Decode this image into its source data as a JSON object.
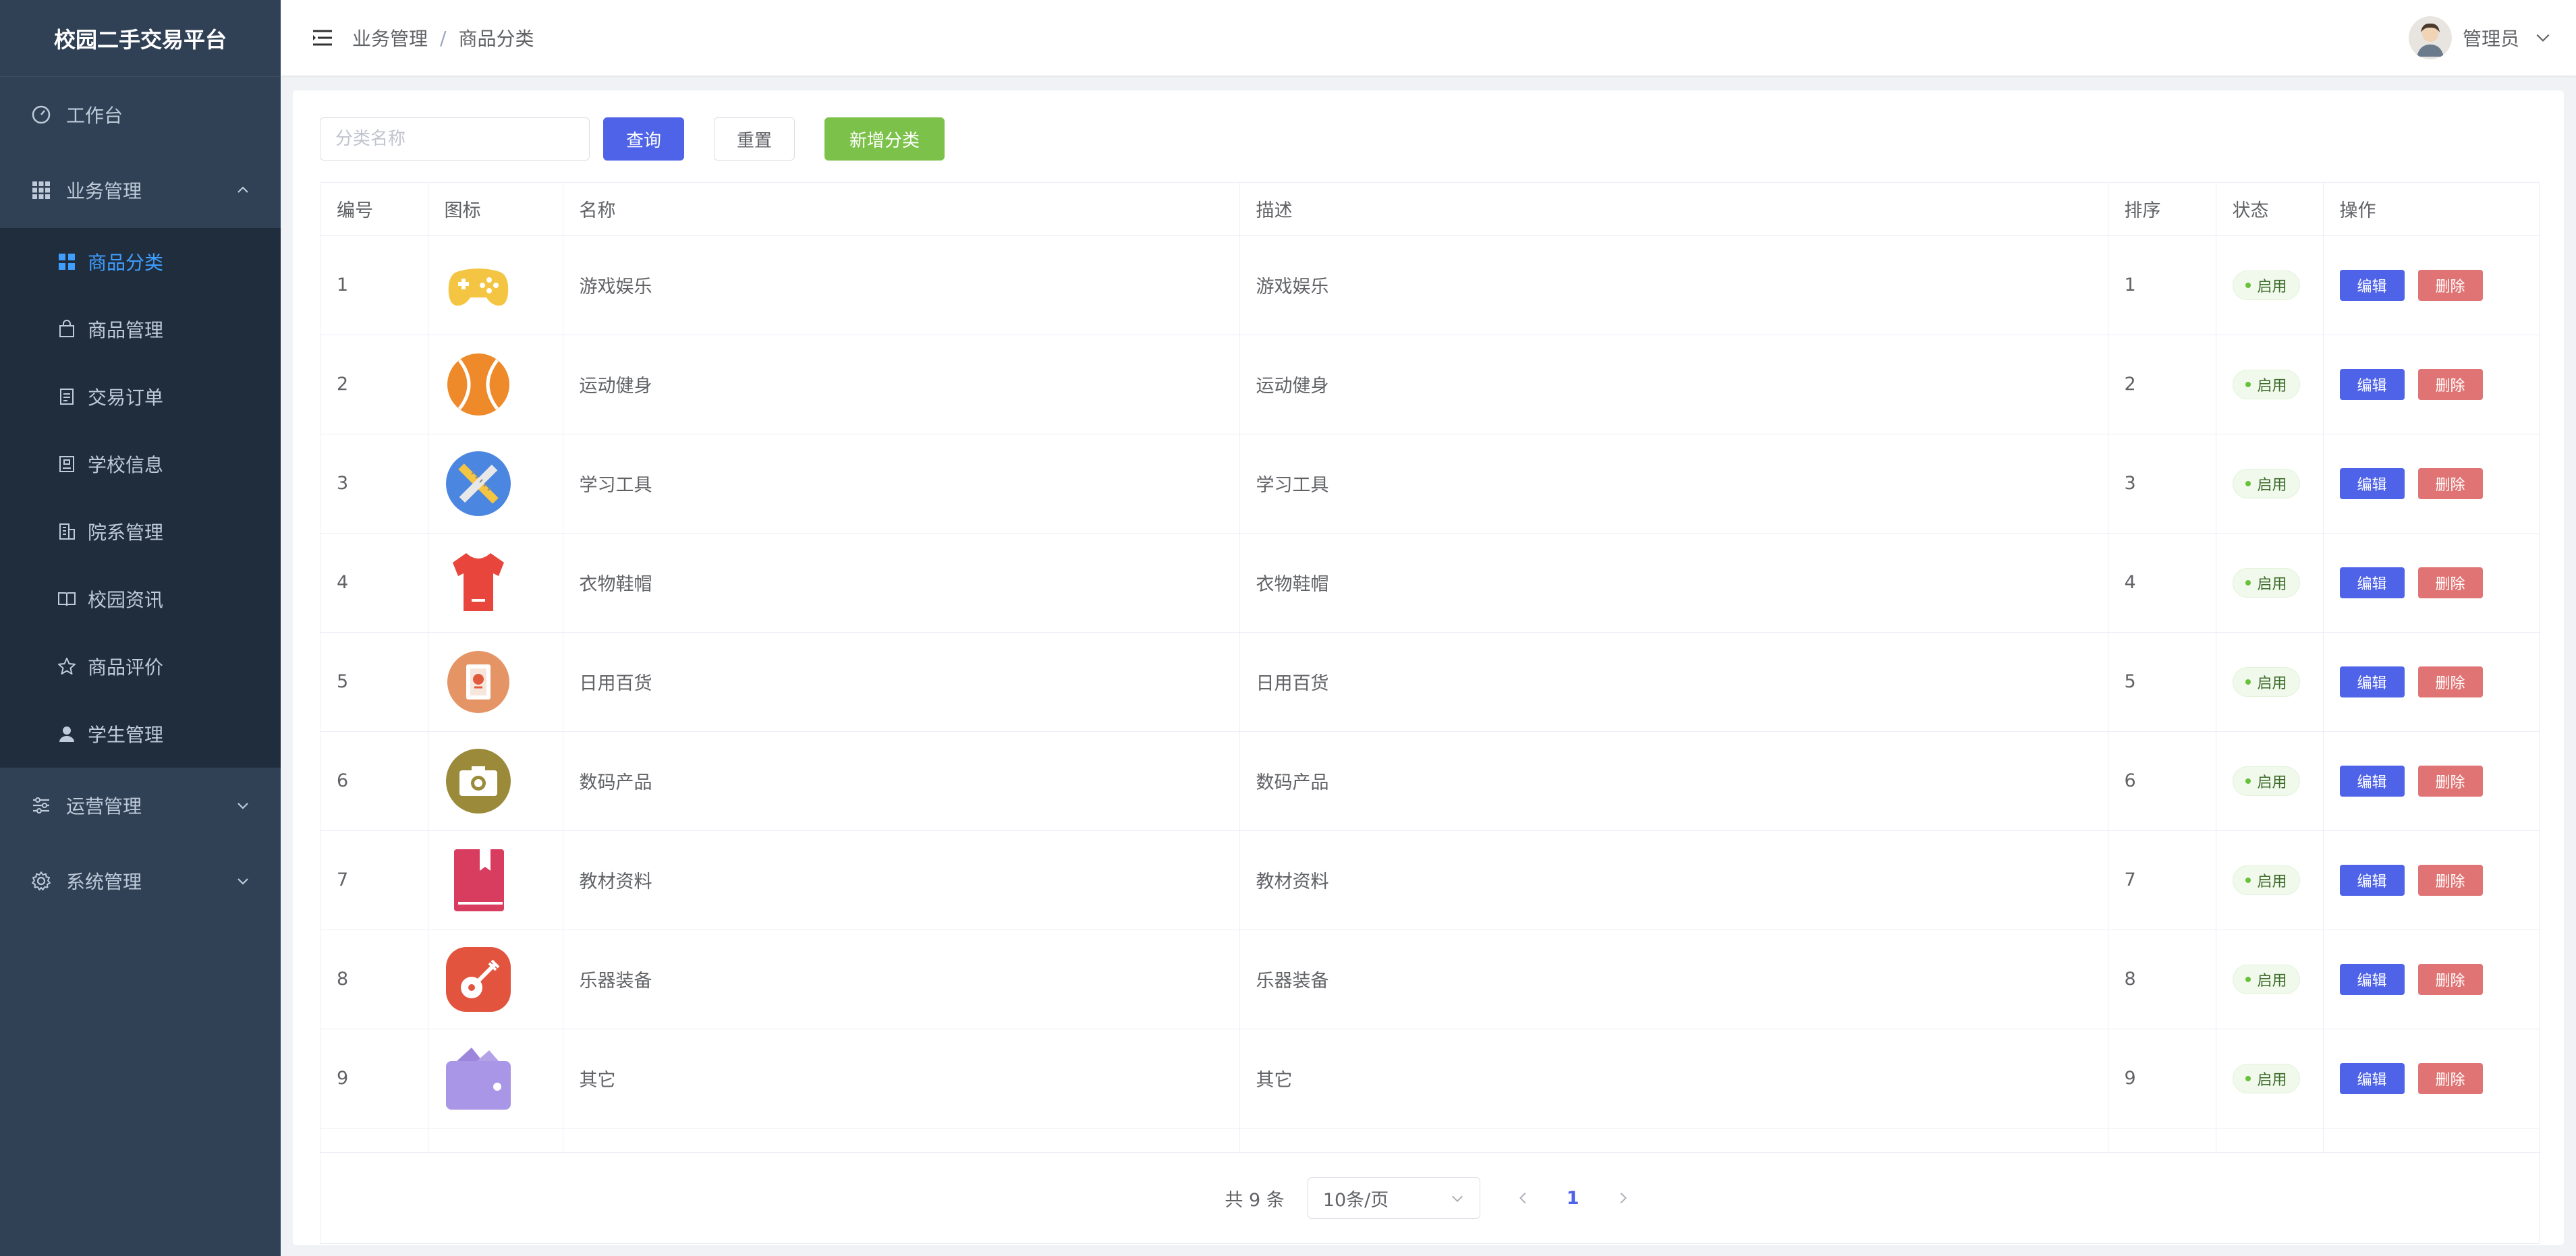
{
  "app": {
    "title": "校园二手交易平台"
  },
  "sidebar": {
    "workbench": "工作台",
    "business": {
      "label": "业务管理",
      "items": [
        "商品分类",
        "商品管理",
        "交易订单",
        "学校信息",
        "院系管理",
        "校园资讯",
        "商品评价",
        "学生管理"
      ]
    },
    "operation": "运营管理",
    "system": "系统管理"
  },
  "header": {
    "breadcrumb": [
      "业务管理",
      "商品分类"
    ],
    "breadcrumb_sep": "/",
    "user": "管理员"
  },
  "toolbar": {
    "search_placeholder": "分类名称",
    "query": "查询",
    "reset": "重置",
    "add": "新增分类"
  },
  "table": {
    "columns": [
      "编号",
      "图标",
      "名称",
      "描述",
      "排序",
      "状态",
      "操作"
    ],
    "rows": [
      {
        "id": "1",
        "icon": "gamepad-icon",
        "name": "游戏娱乐",
        "desc": "游戏娱乐",
        "sort": "1",
        "status": "启用"
      },
      {
        "id": "2",
        "icon": "ball-icon",
        "name": "运动健身",
        "desc": "运动健身",
        "sort": "2",
        "status": "启用"
      },
      {
        "id": "3",
        "icon": "ruler-pencil-icon",
        "name": "学习工具",
        "desc": "学习工具",
        "sort": "3",
        "status": "启用"
      },
      {
        "id": "4",
        "icon": "shirt-icon",
        "name": "衣物鞋帽",
        "desc": "衣物鞋帽",
        "sort": "4",
        "status": "启用"
      },
      {
        "id": "5",
        "icon": "bag-icon",
        "name": "日用百货",
        "desc": "日用百货",
        "sort": "5",
        "status": "启用"
      },
      {
        "id": "6",
        "icon": "camera-icon",
        "name": "数码产品",
        "desc": "数码产品",
        "sort": "6",
        "status": "启用"
      },
      {
        "id": "7",
        "icon": "book-icon",
        "name": "教材资料",
        "desc": "教材资料",
        "sort": "7",
        "status": "启用"
      },
      {
        "id": "8",
        "icon": "guitar-icon",
        "name": "乐器装备",
        "desc": "乐器装备",
        "sort": "8",
        "status": "启用"
      },
      {
        "id": "9",
        "icon": "wallet-icon",
        "name": "其它",
        "desc": "其它",
        "sort": "9",
        "status": "启用"
      }
    ],
    "edit_label": "编辑",
    "delete_label": "删除"
  },
  "pagination": {
    "total": "共 9 条",
    "page_size": "10条/页",
    "current_page": "1"
  },
  "colors": {
    "sidebar_bg": "#304156",
    "active": "#409eff",
    "primary": "#4e63e8",
    "success": "#7cc24a",
    "danger": "#e07474"
  }
}
